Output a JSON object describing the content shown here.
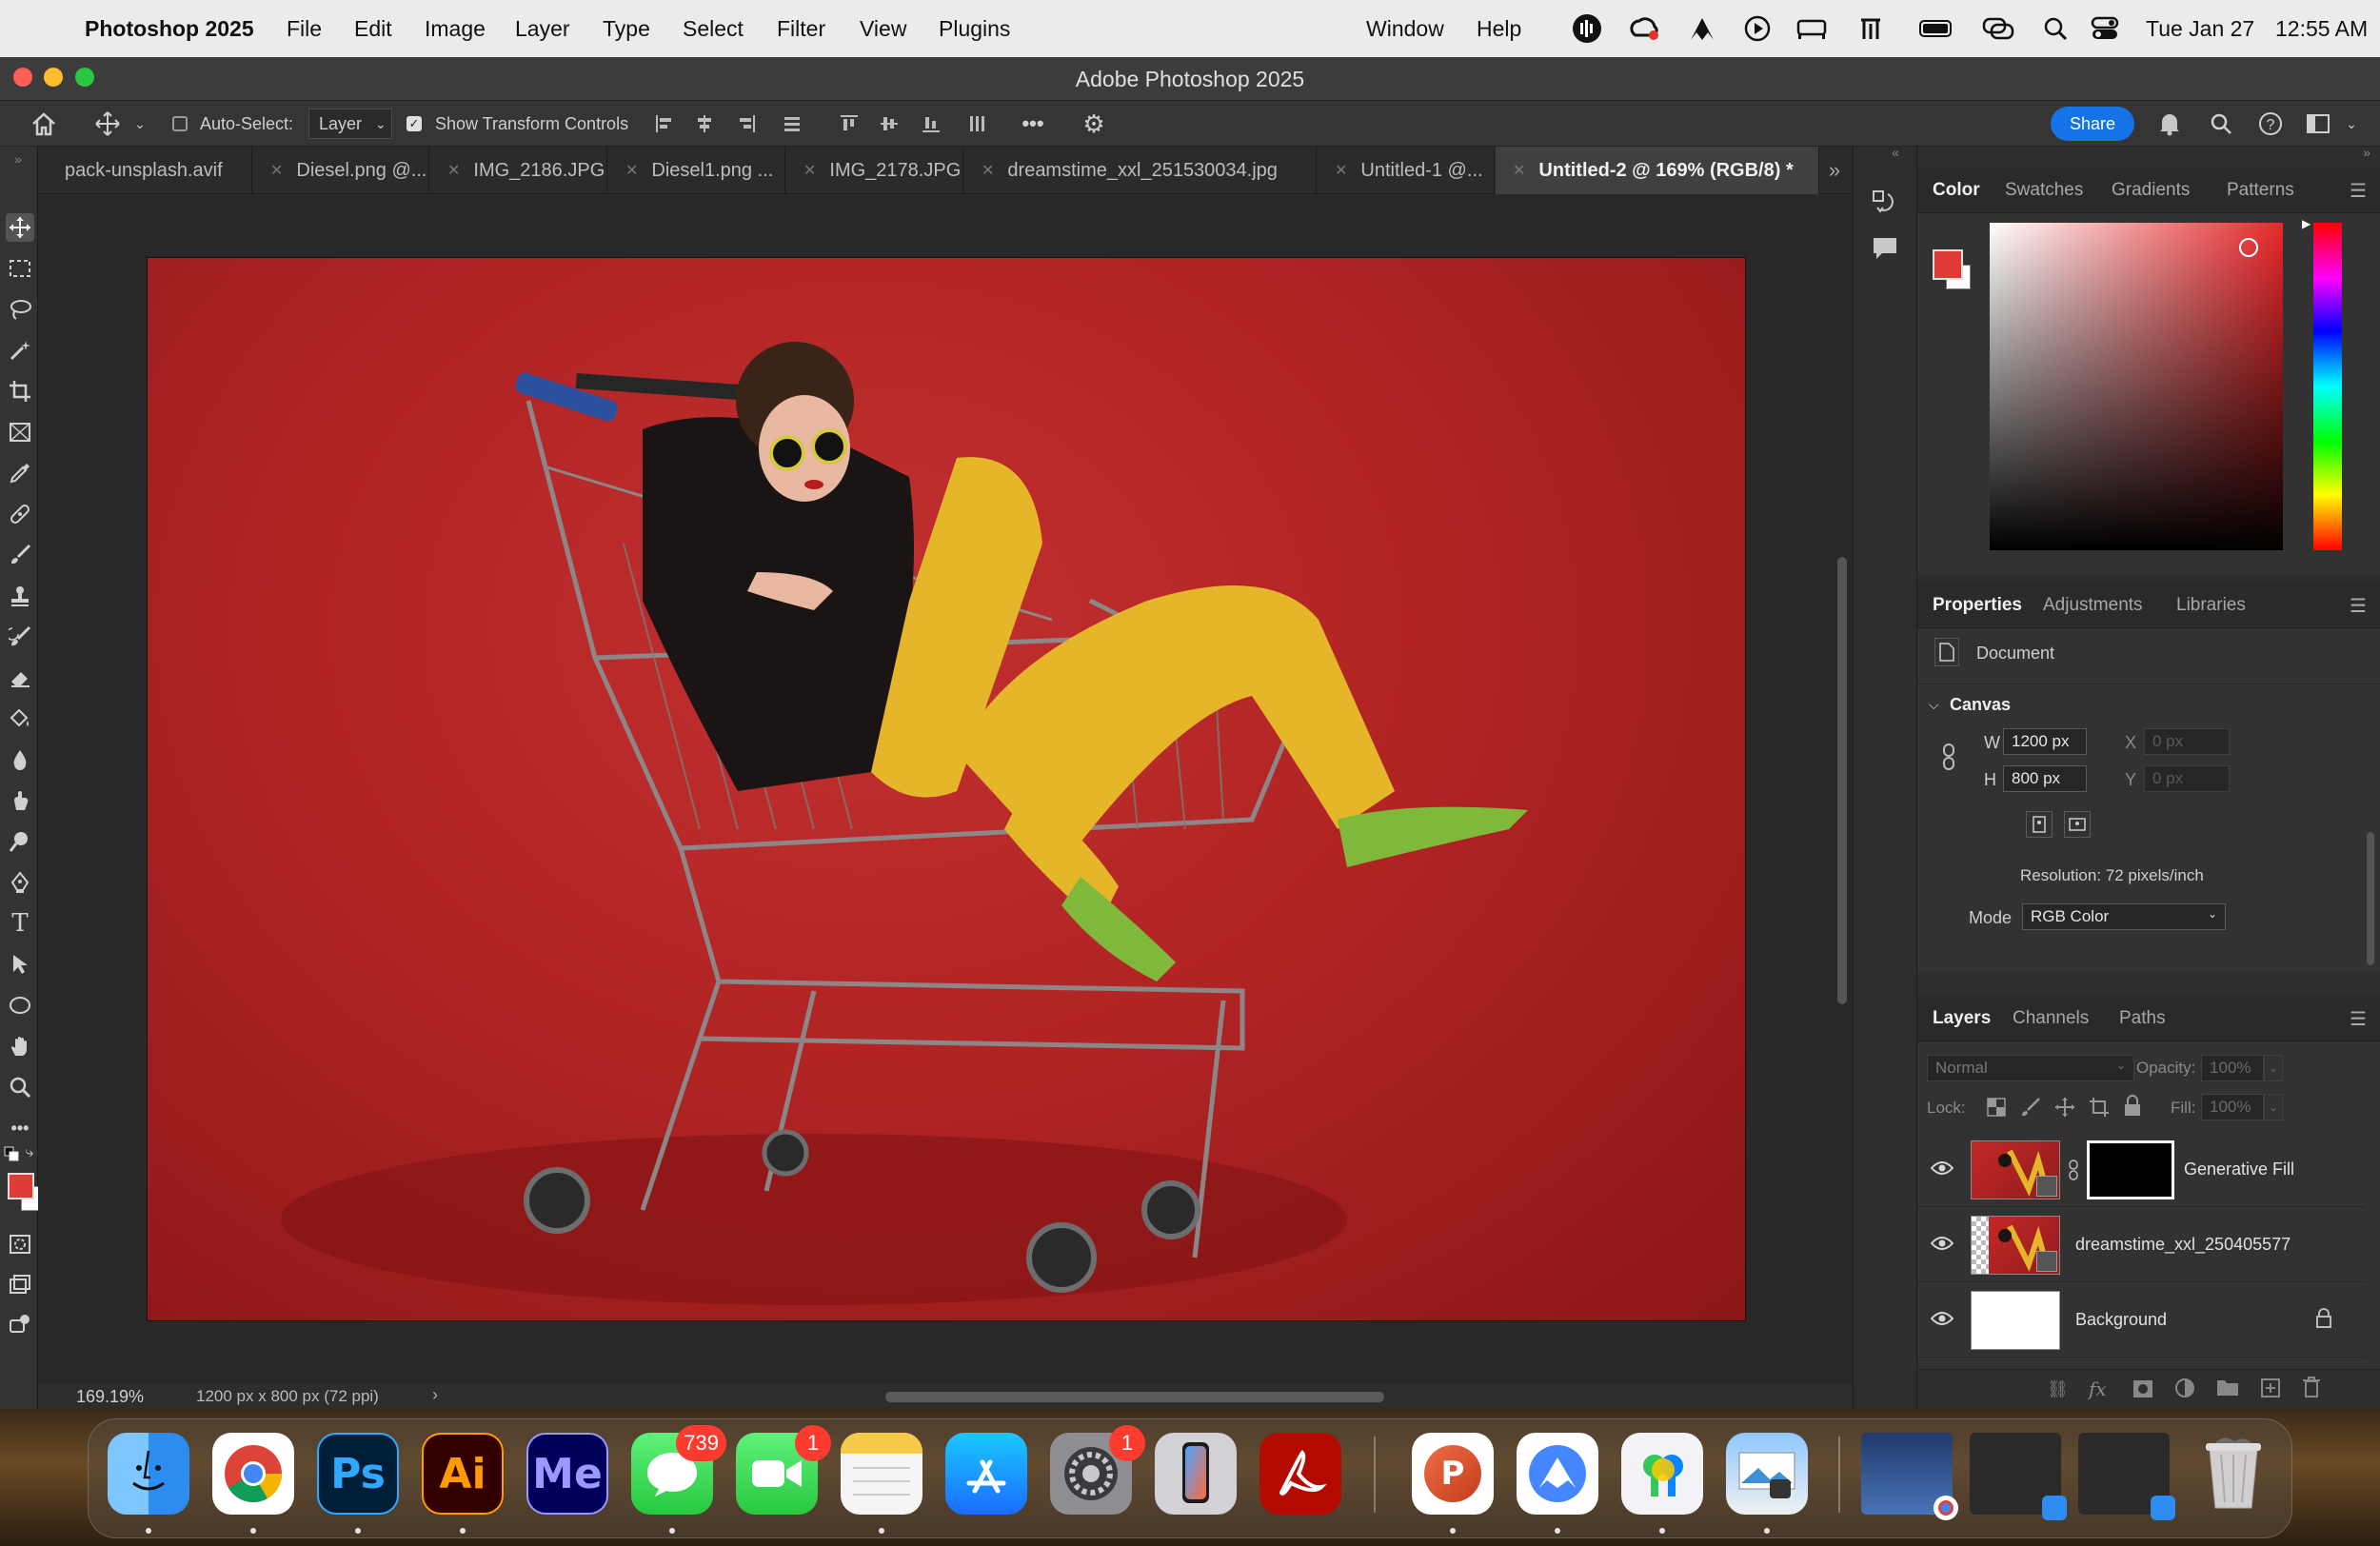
{
  "menubar": {
    "app_name": "Photoshop 2025",
    "menus": [
      "File",
      "Edit",
      "Image",
      "Layer",
      "Type",
      "Select",
      "Filter",
      "View",
      "Plugins"
    ],
    "right_menus": [
      "Window",
      "Help"
    ],
    "date": "Tue Jan 27",
    "time": "12:55 AM"
  },
  "window": {
    "title": "Adobe Photoshop 2025"
  },
  "options": {
    "auto_select_label": "Auto-Select:",
    "auto_select_checked": false,
    "auto_select_target": "Layer",
    "transform_label": "Show Transform Controls",
    "transform_checked": true,
    "share_label": "Share"
  },
  "tabs": [
    {
      "label": "pack-unsplash.avif",
      "active": false
    },
    {
      "label": "Diesel.png @...",
      "active": false
    },
    {
      "label": "IMG_2186.JPG",
      "active": false
    },
    {
      "label": "Diesel1.png ...",
      "active": false
    },
    {
      "label": "IMG_2178.JPG",
      "active": false
    },
    {
      "label": "dreamstime_xxl_251530034.jpg",
      "active": false
    },
    {
      "label": "Untitled-1 @...",
      "active": false
    },
    {
      "label": "Untitled-2 @ 169% (RGB/8) *",
      "active": true
    }
  ],
  "status": {
    "zoom": "169.19%",
    "doc_info": "1200 px x 800 px (72 ppi)"
  },
  "color_panel": {
    "tabs": [
      "Color",
      "Swatches",
      "Gradients",
      "Patterns"
    ],
    "active_tab": "Color",
    "foreground": "#e03a36",
    "background": "#ffffff"
  },
  "properties": {
    "tabs": [
      "Properties",
      "Adjustments",
      "Libraries"
    ],
    "active_tab": "Properties",
    "doc_label": "Document",
    "section": "Canvas",
    "w_label": "W",
    "w_value": "1200 px",
    "h_label": "H",
    "h_value": "800 px",
    "x_label": "X",
    "x_placeholder": "0 px",
    "y_label": "Y",
    "y_placeholder": "0 px",
    "resolution": "Resolution: 72 pixels/inch",
    "mode_label": "Mode",
    "mode_value": "RGB Color"
  },
  "layers_panel": {
    "tabs": [
      "Layers",
      "Channels",
      "Paths"
    ],
    "active_tab": "Layers",
    "blend_mode": "Normal",
    "opacity_label": "Opacity:",
    "opacity_value": "100%",
    "lock_label": "Lock:",
    "fill_label": "Fill:",
    "fill_value": "100%",
    "layers": [
      {
        "name": "Generative Fill",
        "visible": true
      },
      {
        "name": "dreamstime_xxl_250405577",
        "visible": true
      },
      {
        "name": "Background",
        "visible": true,
        "locked": true
      }
    ]
  },
  "dock": {
    "apps": [
      {
        "name": "Finder",
        "glyph": "",
        "color": "#2d8cf0"
      },
      {
        "name": "Chrome",
        "glyph": "",
        "color": "#ffffff"
      },
      {
        "name": "Photoshop",
        "glyph": "Ps",
        "color": "#001e36"
      },
      {
        "name": "Illustrator",
        "glyph": "Ai",
        "color": "#330000"
      },
      {
        "name": "Media Encoder",
        "glyph": "Me",
        "color": "#00005b"
      },
      {
        "name": "Messages",
        "glyph": "",
        "color": "#34c759",
        "badge": "739"
      },
      {
        "name": "FaceTime",
        "glyph": "",
        "color": "#30d158",
        "badge": "1"
      },
      {
        "name": "Notes",
        "glyph": "",
        "color": "#f5f5f5"
      },
      {
        "name": "App Store",
        "glyph": "",
        "color": "#1a8cff"
      },
      {
        "name": "System Settings",
        "glyph": "",
        "color": "#8e8e93",
        "badge": "1"
      },
      {
        "name": "iPhone Mirroring",
        "glyph": "",
        "color": "#c7c7cc"
      },
      {
        "name": "Acrobat",
        "glyph": "",
        "color": "#b30b00"
      },
      {
        "name": "PowerPoint",
        "glyph": "P",
        "color": "#ffffff"
      },
      {
        "name": "NordVPN",
        "glyph": "",
        "color": "#ffffff"
      },
      {
        "name": "Passwords",
        "glyph": "",
        "color": "#f2f2f7"
      },
      {
        "name": "Preview",
        "glyph": "",
        "color": "#e5e5ea"
      }
    ]
  }
}
